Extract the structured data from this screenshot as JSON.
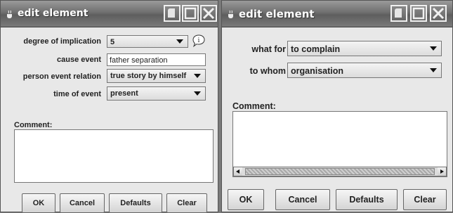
{
  "colors": {
    "title_bar": "#6f6f6f",
    "window_bg": "#e8e8e8",
    "desktop": "#7a7a7a"
  },
  "window1": {
    "title": "edit element",
    "fields": {
      "degree_label": "degree of implication",
      "degree_value": "5",
      "cause_label": "cause event",
      "cause_value": "father separation",
      "relation_label": "person event relation",
      "relation_value": "true story by himself",
      "time_label": "time of event",
      "time_value": "present"
    },
    "comment_label": "Comment:",
    "buttons": {
      "ok": "OK",
      "cancel": "Cancel",
      "defaults": "Defaults",
      "clear": "Clear"
    }
  },
  "window2": {
    "title": "edit element",
    "fields": {
      "what_for_label": "what for",
      "what_for_value": "to complain",
      "to_whom_label": "to whom",
      "to_whom_value": "organisation"
    },
    "comment_label": "Comment:",
    "buttons": {
      "ok": "OK",
      "cancel": "Cancel",
      "defaults": "Defaults",
      "clear": "Clear"
    }
  }
}
